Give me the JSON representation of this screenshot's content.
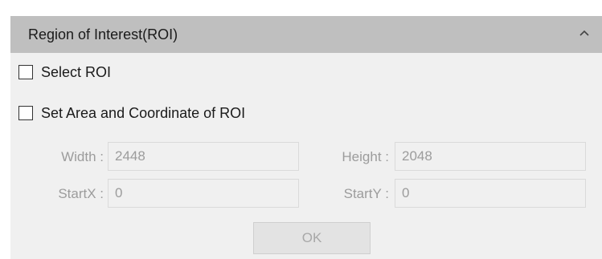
{
  "panel": {
    "title": "Region of Interest(ROI)",
    "collapse_icon": "chevron-up-icon",
    "colors": {
      "header_bg": "#bfbfbf",
      "body_bg": "#f0f0f0",
      "disabled_text": "#9c9c9c"
    }
  },
  "select_roi": {
    "label": "Select ROI",
    "checked": false
  },
  "set_area": {
    "label": "Set Area and Coordinate of ROI",
    "checked": false
  },
  "fields": {
    "width": {
      "label": "Width :",
      "value": "2448"
    },
    "height": {
      "label": "Height :",
      "value": "2048"
    },
    "start_x": {
      "label": "StartX :",
      "value": "0"
    },
    "start_y": {
      "label": "StartY :",
      "value": "0"
    }
  },
  "ok_button": {
    "label": "OK",
    "enabled": false
  }
}
